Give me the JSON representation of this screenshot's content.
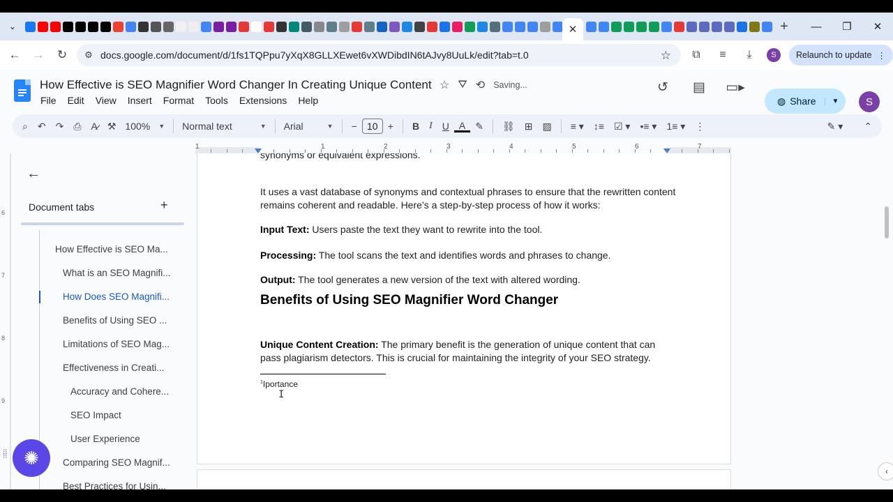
{
  "browser": {
    "favicon_colors": [
      "#1877f2",
      "#ff0000",
      "#ff0000",
      "#000000",
      "#000000",
      "#000000",
      "#000000",
      "#ea4335",
      "#4285f4",
      "#333333",
      "#555555",
      "#666666",
      "#f0f0f0",
      "#eeeeee",
      "#4285f4",
      "#7b1fa2",
      "#7b1fa2",
      "#e53935",
      "#ffffff",
      "#e53935",
      "#333333",
      "#00897b",
      "#455a64",
      "#888888",
      "#607d8b",
      "#9e9e9e",
      "#e53935",
      "#607d8b",
      "#1565c0",
      "#7e57c2",
      "#1e88e5",
      "#424242",
      "#e53935",
      "#1a73e8",
      "#e91e63",
      "#0f9d58",
      "#1e88e5",
      "#546e7a",
      "#4285f4",
      "#4285f4",
      "#4285f4",
      "#9e9e9e",
      "#4285f4",
      "#1a73e8",
      "#4285f4"
    ],
    "favicon_colors_2": [
      "#4285f4",
      "#4285f4",
      "#0f9d58",
      "#0f9d58",
      "#0f9d58",
      "#0f9d58",
      "#4285f4",
      "#e53935",
      "#5c6bc0",
      "#5c6bc0",
      "#5c6bc0",
      "#5c6bc0",
      "#1a73e8",
      "#827717",
      "#4285f4",
      "#827717",
      "#333333"
    ],
    "active_tab_close": "✕",
    "new_tab": "+",
    "url": "docs.google.com/document/d/1fs1TQPpu7yXqX8GLLXEwet6vXWDibdIN6tAJvy8UuLk/edit?tab=t.0",
    "profile_initial": "S",
    "relaunch_label": "Relaunch to update"
  },
  "docs": {
    "title": "How Effective is SEO Magnifier Word Changer In Creating Unique Content",
    "saving_status": "Saving...",
    "menu": [
      "File",
      "Edit",
      "View",
      "Insert",
      "Format",
      "Tools",
      "Extensions",
      "Help"
    ],
    "share_label": "Share",
    "user_initial": "S",
    "accent_color": "#c2e7ff"
  },
  "toolbar": {
    "zoom": "100%",
    "style": "Normal text",
    "font": "Arial",
    "font_size": "10",
    "minus": "−",
    "plus": "+"
  },
  "panel": {
    "title": "Document tabs",
    "add": "+",
    "outline": [
      {
        "label": "How Effective is SEO Ma...",
        "level": 0,
        "active": false
      },
      {
        "label": "What is an SEO Magnifi...",
        "level": 1,
        "active": false
      },
      {
        "label": "How Does SEO Magnifi...",
        "level": 1,
        "active": true
      },
      {
        "label": "Benefits of Using SEO ...",
        "level": 1,
        "active": false
      },
      {
        "label": "Limitations of SEO Mag...",
        "level": 1,
        "active": false
      },
      {
        "label": "Effectiveness in Creati...",
        "level": 1,
        "active": false
      },
      {
        "label": "Accuracy and Cohere...",
        "level": 2,
        "active": false
      },
      {
        "label": "SEO Impact",
        "level": 2,
        "active": false
      },
      {
        "label": "User Experience",
        "level": 2,
        "active": false
      },
      {
        "label": "Comparing SEO Magnif...",
        "level": 1,
        "active": false
      },
      {
        "label": "Best Practices for Usin...",
        "level": 1,
        "active": false
      }
    ]
  },
  "ruler": {
    "labels": [
      "1",
      "1",
      "2",
      "3",
      "4",
      "5",
      "6",
      "7"
    ],
    "vertical_labels": [
      "6",
      "7",
      "8",
      "9"
    ]
  },
  "content": {
    "cut_line": "synonyms or equivalent expressions.",
    "para1": "It uses a vast database of synonyms and contextual phrases to ensure that the rewritten content remains coherent and readable. Here’s a step-by-step process of how it works:",
    "item1_label": "Input Text:",
    "item1_text": " Users paste the text they want to rewrite into the tool.",
    "item2_label": "Processing:",
    "item2_text": " The tool scans the text and identifies words and phrases to change.",
    "item3_label": "Output:",
    "item3_text": " The tool generates a new version of the text with altered wording.",
    "heading": "Benefits of Using SEO Magnifier Word Changer",
    "item4_label": "Unique Content Creation:",
    "item4_text": " The primary benefit is the generation of unique content that can pass plagiarism detectors. This is crucial for maintaining the integrity of your SEO strategy.",
    "footnote_mark": "1",
    "footnote_text": "Iportance"
  }
}
